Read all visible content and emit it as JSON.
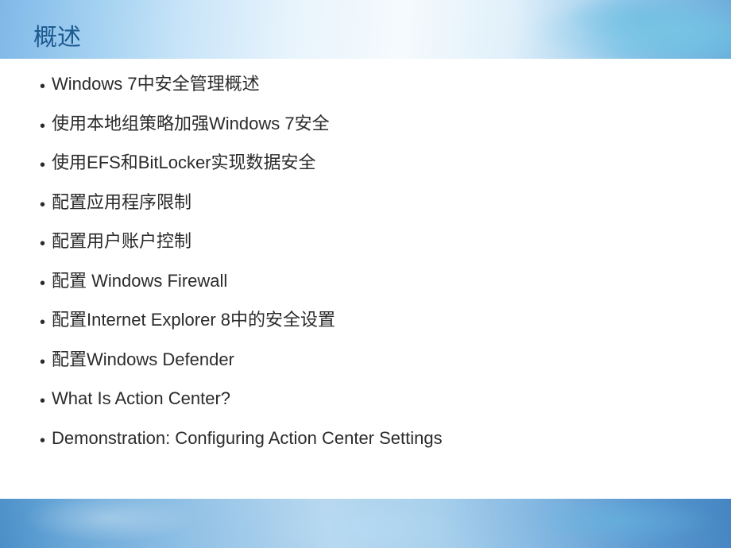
{
  "slide": {
    "title": "概述",
    "bullets": [
      "Windows 7中安全管理概述",
      "使用本地组策略加强Windows 7安全",
      "使用EFS和BitLocker实现数据安全",
      "配置应用程序限制",
      "配置用户账户控制",
      "配置 Windows Firewall",
      "配置Internet Explorer 8中的安全设置",
      "配置Windows Defender",
      "What Is Action Center?",
      "Demonstration: Configuring Action Center Settings"
    ]
  }
}
